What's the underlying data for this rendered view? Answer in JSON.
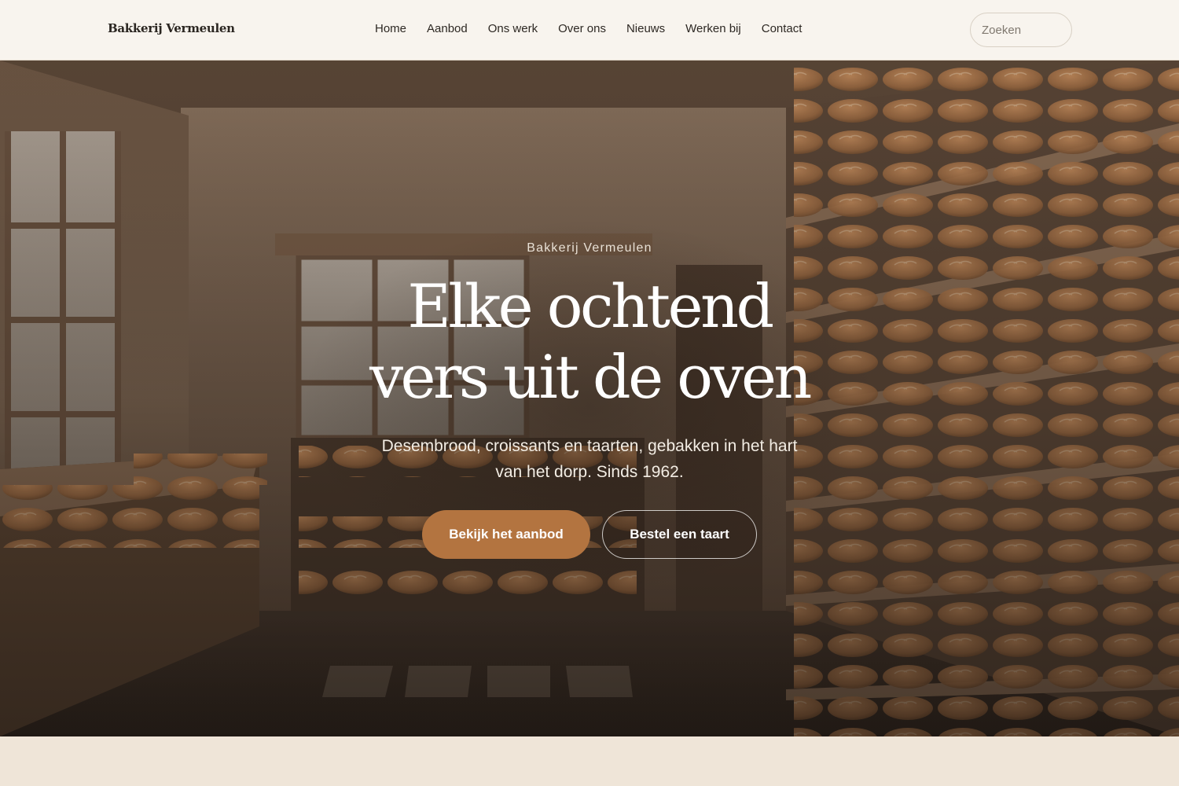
{
  "header": {
    "logo": "Bakkerij Vermeulen",
    "nav": [
      {
        "label": "Home"
      },
      {
        "label": "Aanbod"
      },
      {
        "label": "Ons werk"
      },
      {
        "label": "Over ons"
      },
      {
        "label": "Nieuws"
      },
      {
        "label": "Werken bij"
      },
      {
        "label": "Contact"
      }
    ],
    "search": {
      "placeholder": "Zoeken",
      "value": ""
    }
  },
  "hero": {
    "eyebrow": "Bakkerij Vermeulen",
    "title_line1": "Elke ochtend",
    "title_line2": "vers uit de oven",
    "subtitle_line1": "Desembrood, croissants en taarten, gebakken in het hart",
    "subtitle_line2": "van het dorp. Sinds 1962.",
    "primary_button": "Bekijk het aanbod",
    "secondary_button": "Bestel een taart"
  },
  "colors": {
    "header_bg": "#f8f4ee",
    "accent": "#b37440",
    "page_bg": "#efe5d8",
    "text_dark": "#2b2621"
  }
}
